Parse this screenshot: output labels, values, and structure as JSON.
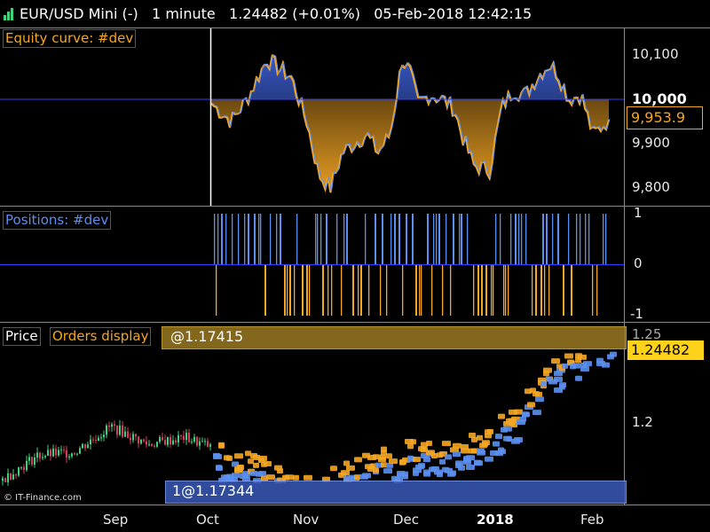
{
  "title": {
    "instrument": "EUR/USD Mini (-)",
    "timeframe": "1 minute",
    "price_change": "1.24482 (+0.01%)",
    "datetime": "05-Feb-2018 12:42:15"
  },
  "colors": {
    "background": "#000000",
    "orange": "#f5a623",
    "blue": "#5b8ff0",
    "baseline": "#3040ff",
    "green_candle": "#3fd07a",
    "red_candle": "#d63d5c",
    "separator": "#8a8a8a"
  },
  "panels": {
    "equity": {
      "label": "Equity curve: #dev",
      "current_value": "9,953.9"
    },
    "positions": {
      "label": "Positions: #dev"
    },
    "price": {
      "label_price": "Price",
      "label_orders": "Orders display",
      "top_marker": "@1.17415",
      "bottom_marker": "1@1.17344",
      "current_price": "1.24482",
      "partial_top_tick": "1.25"
    }
  },
  "copyright": "© IT-Finance.com",
  "chart_data": [
    {
      "type": "area",
      "panel": "equity",
      "title": "Equity curve: #dev",
      "baseline": 10000,
      "ylim": [
        9760,
        10160
      ],
      "y_ticks": [
        "10,100",
        "10,000",
        "9,900",
        "9,800"
      ],
      "y_tick_values": [
        10100,
        10000,
        9900,
        9800
      ],
      "current_value": 9953.9,
      "x_fraction": [
        0,
        0.05,
        0.09,
        0.14,
        0.2,
        0.24,
        0.27,
        0.3,
        0.33,
        0.36,
        0.39,
        0.42,
        0.45,
        0.48,
        0.5,
        0.52,
        0.55,
        0.58,
        0.61,
        0.63,
        0.66,
        0.7,
        0.73,
        0.76,
        0.79,
        0.82,
        0.85,
        0.87,
        0.9,
        0.93,
        0.96,
        1
      ],
      "values": [
        9990,
        9950,
        10000,
        10090,
        10050,
        9950,
        9830,
        9800,
        9880,
        9900,
        9920,
        9880,
        9920,
        10090,
        10060,
        9990,
        10010,
        10000,
        9980,
        9920,
        9850,
        9840,
        9980,
        10020,
        10010,
        10050,
        10080,
        10060,
        10000,
        10010,
        9920,
        9953.9
      ]
    },
    {
      "type": "bar",
      "panel": "positions",
      "title": "Positions: #dev",
      "y_ticks": [
        "1",
        "0",
        "-1"
      ],
      "y_tick_values": [
        1,
        0,
        -1
      ],
      "ylim": [
        -1,
        1
      ]
    },
    {
      "type": "line",
      "panel": "price",
      "title": "Price",
      "y_ticks": [
        "1.2"
      ],
      "y_tick_values": [
        1.2
      ],
      "ylim": [
        1.155,
        1.255
      ],
      "current_price": 1.24482,
      "x_ticks": [
        "Sep",
        "Oct",
        "Nov",
        "Dec",
        "2018",
        "Feb"
      ],
      "x_fraction": [
        0,
        0.06,
        0.12,
        0.18,
        0.24,
        0.3,
        0.34,
        0.36,
        0.42,
        0.46,
        0.5,
        0.55,
        0.6,
        0.64,
        0.68,
        0.72,
        0.76,
        0.8,
        0.84,
        0.88,
        0.92,
        0.96,
        1
      ],
      "values": [
        1.168,
        1.182,
        1.184,
        1.198,
        1.188,
        1.192,
        1.187,
        1.178,
        1.174,
        1.165,
        1.162,
        1.168,
        1.175,
        1.179,
        1.184,
        1.18,
        1.185,
        1.193,
        1.2,
        1.222,
        1.232,
        1.24,
        1.245
      ]
    }
  ]
}
